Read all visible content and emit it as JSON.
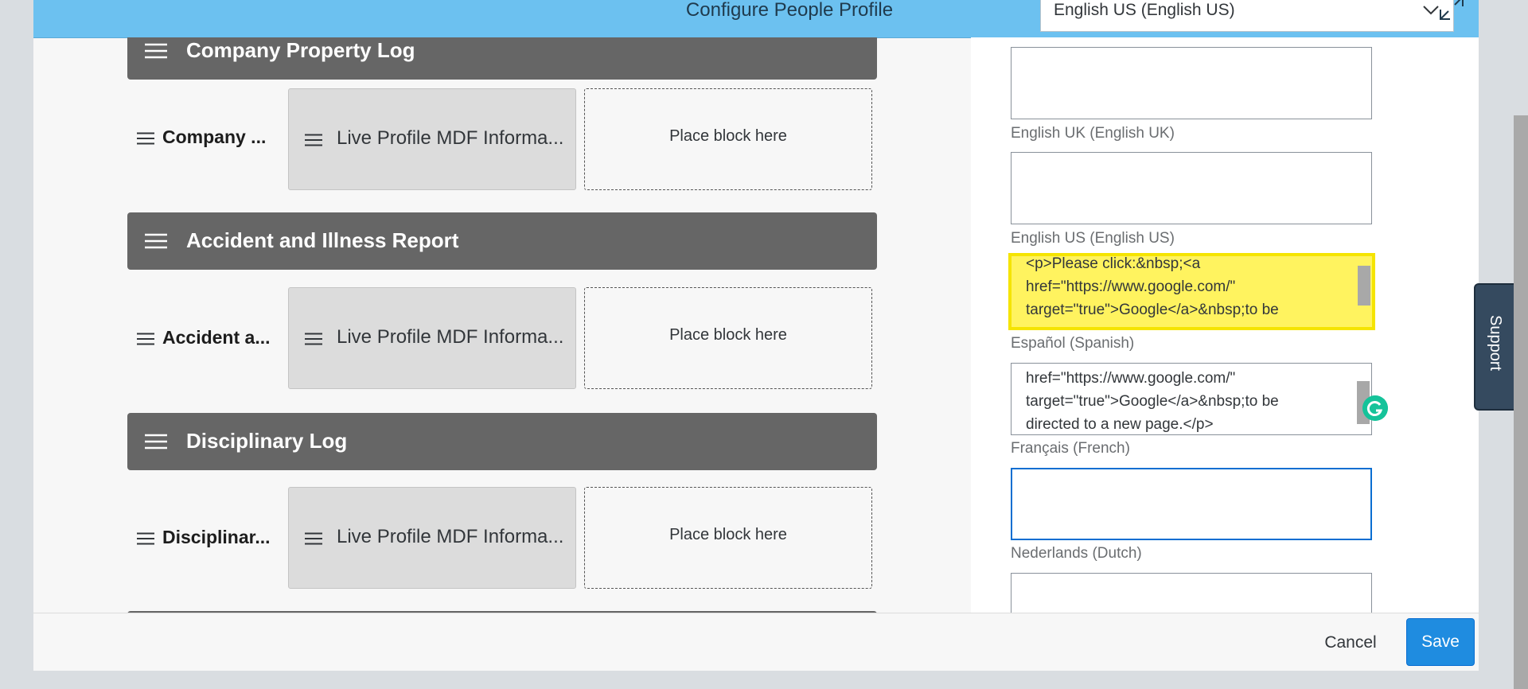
{
  "header": {
    "title": "Configure People Profile",
    "language_selected": "English US (English US)"
  },
  "sections": [
    {
      "title": "Company Property Log",
      "row_label": "Company ...",
      "block_label": "Live Profile MDF Informa...",
      "placeholder": "Place block here"
    },
    {
      "title": "Accident and Illness Report",
      "row_label": "Accident a...",
      "block_label": "Live Profile MDF Informa...",
      "placeholder": "Place block here"
    },
    {
      "title": "Disciplinary Log",
      "row_label": "Disciplinar...",
      "block_label": "Live Profile MDF Informa...",
      "placeholder": "Place block here"
    }
  ],
  "translations": {
    "english_uk_label": "English UK (English UK)",
    "english_us_label": "English US (English US)",
    "english_us_value": "<p>Please click:&nbsp;<a\nhref=\"https://www.google.com/\"\ntarget=\"true\">Google</a>&nbsp;to be",
    "spanish_label": "Español (Spanish)",
    "spanish_value": "href=\"https://www.google.com/\"\ntarget=\"true\">Google</a>&nbsp;to be\ndirected to a new page.</p>",
    "french_label": "Français (French)",
    "dutch_label": "Nederlands (Dutch)"
  },
  "support": {
    "label": "Support"
  },
  "footer": {
    "cancel_label": "Cancel",
    "save_label": "Save"
  },
  "icons": {
    "hamburger": "drag-handle-icon",
    "chevron": "chevron-down-icon",
    "expand": "expand-icon",
    "grammarly": "grammarly-icon"
  },
  "colors": {
    "header_bg": "#6cc1f0",
    "section_header_bg": "#666666",
    "highlight": "#fff35f",
    "save_button": "#1f8ce0",
    "support_tab": "#354a5f"
  }
}
